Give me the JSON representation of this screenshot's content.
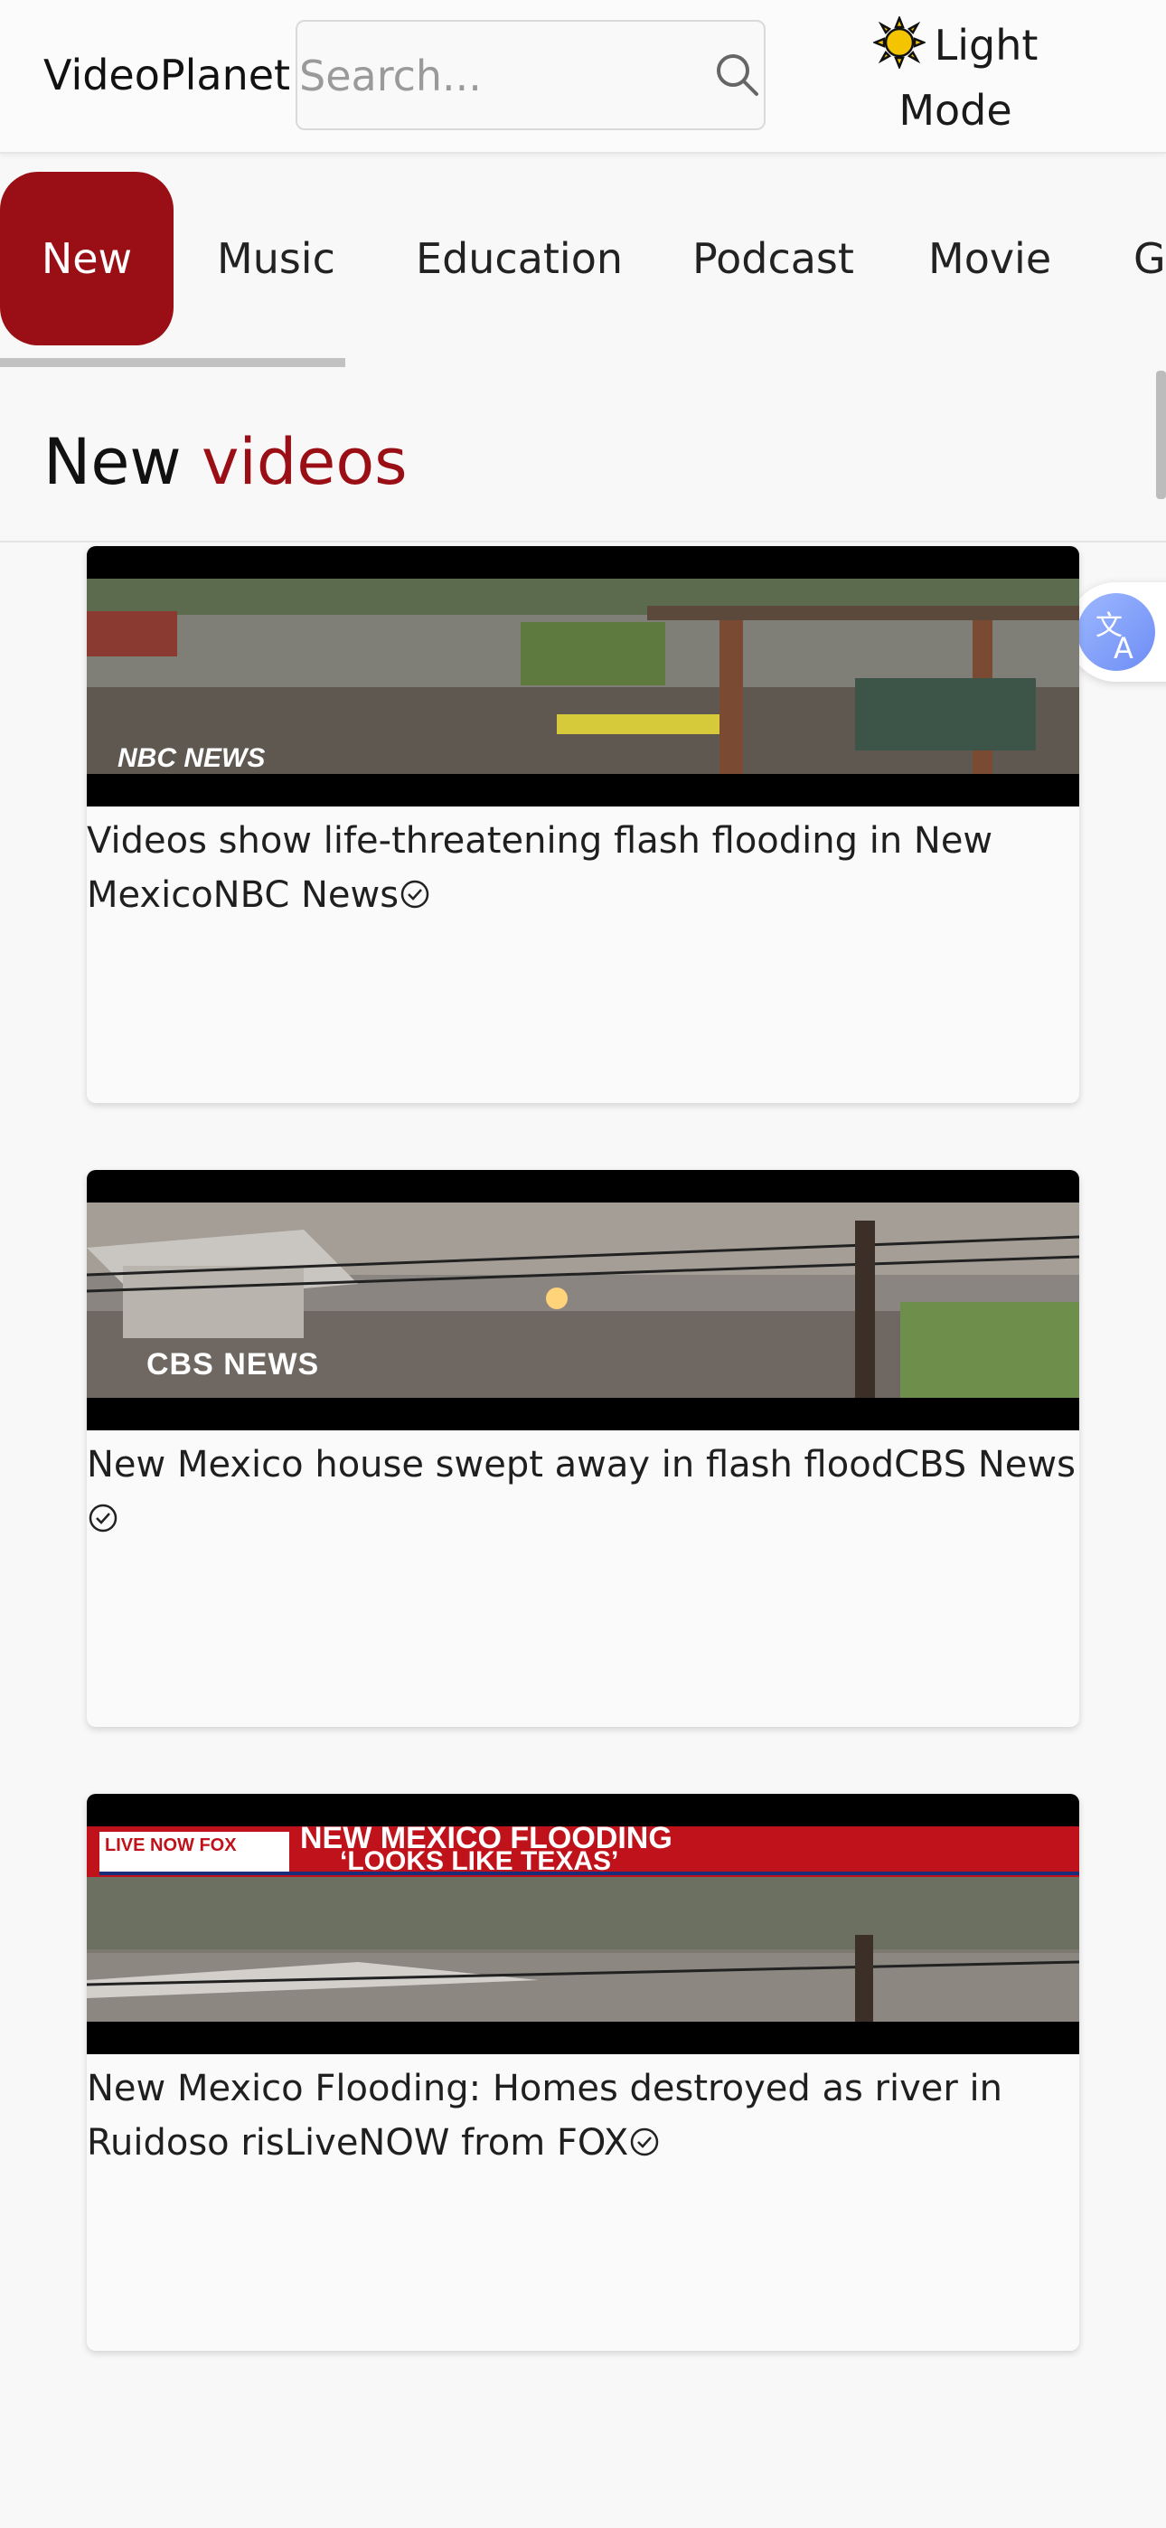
{
  "header": {
    "brand": "VideoPlanet",
    "search_placeholder": "Search...",
    "mode_toggle": {
      "line1": "Light",
      "line2": "Mode"
    }
  },
  "tabs": [
    "New",
    "Music",
    "Education",
    "Podcast",
    "Movie",
    "Ga"
  ],
  "section": {
    "title_plain": "New",
    "title_accent": "videos"
  },
  "videos": [
    {
      "title": "Videos show life-threatening flash flooding in New Mexico",
      "channel": "NBC News",
      "watermark": "NBC NEWS"
    },
    {
      "title": "New Mexico house swept away in flash flood",
      "channel": "CBS News",
      "watermark": "CBS NEWS"
    },
    {
      "title": "New Mexico Flooding: Homes destroyed as river in Ruidoso ris",
      "channel": "LiveNOW from FOX",
      "watermark": "LIVE NOW FOX",
      "banner_line1": "NEW MEXICO FLOODING",
      "banner_line2": "‘LOOKS LIKE TEXAS’"
    }
  ],
  "colors": {
    "accent": "#9a0f15",
    "background": "#f8f8f8"
  }
}
